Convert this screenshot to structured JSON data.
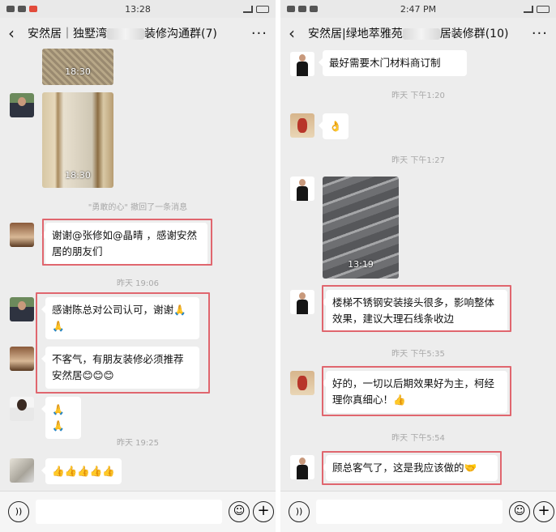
{
  "left": {
    "status": {
      "time": "13:28"
    },
    "title": {
      "prefix": "安然居｜独墅湾",
      "suffix": "装修沟通群(7)"
    },
    "photos": [
      {
        "time": "18:30"
      },
      {
        "time": "18:30"
      }
    ],
    "recall_notice": "\"勇敢的心\" 撤回了一条消息",
    "messages": {
      "m1": "谢谢@张修如@晶晴 ，感谢安然居的朋友们",
      "m2": "感谢陈总对公司认可，谢谢🙏🙏",
      "m3": "不客气，有朋友装修必须推荐安然居😊😊😊",
      "m4": "🙏🙏",
      "m5": "👍👍👍👍👍"
    },
    "timestamps": {
      "t1": "昨天 19:06",
      "t2": "昨天 19:25"
    }
  },
  "right": {
    "status": {
      "time": "2:47 PM"
    },
    "title": {
      "prefix": "安然居|绿地萃雅苑",
      "suffix": "居装修群(10)"
    },
    "messages": {
      "m1": "最好需要木门材料商订制",
      "m2": "👌",
      "m3": "楼梯不锈钢安装接头很多，影响整体效果，建议大理石线条收边",
      "m4": "好的，一切以后期效果好为主，柯经理你真细心！👍",
      "m5": "顾总客气了，这是我应该做的🤝"
    },
    "timestamps": {
      "t1": "昨天 下午1:20",
      "t2": "昨天 下午1:27",
      "t3": "昨天 下午5:35",
      "t4": "昨天 下午5:54"
    },
    "photo": {
      "time": "13:19"
    }
  },
  "icons": {
    "back": "‹",
    "more": "···",
    "voice": "))",
    "emoji": "☺",
    "plus": "+"
  },
  "colors": {
    "highlight": "#e0666e",
    "chat_bg": "#ededed",
    "bubble": "#ffffff"
  }
}
